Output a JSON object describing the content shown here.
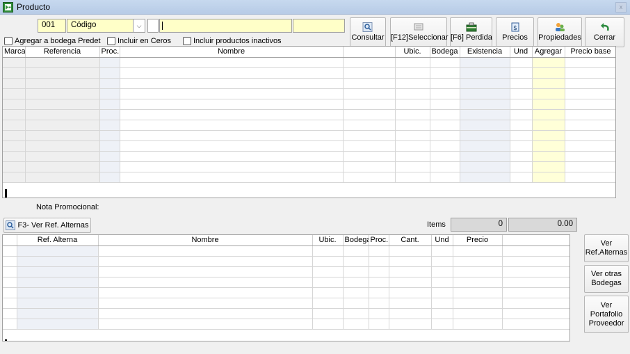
{
  "window": {
    "title": "Producto",
    "close_glyph": "x"
  },
  "search_bar": {
    "code_value": "001",
    "search_by_value": "Código",
    "search_value": "",
    "extra_value": ""
  },
  "options": {
    "add_default_warehouse": "Agregar a bodega Predet",
    "include_zeros": "Incluir en Ceros",
    "include_inactive": "Incluir productos inactivos"
  },
  "toolbar": {
    "consultar": "Consultar",
    "seleccionar": "[F12]Seleccionar",
    "perdida": "[F6] Perdida",
    "precios": "Precios",
    "propiedades": "Propiedades",
    "cerrar": "Cerrar"
  },
  "products_grid": {
    "columns": [
      "Marca",
      "Referencia",
      "Proc.",
      "Nombre",
      "",
      "Ubic.",
      "Bodega",
      "Existencia",
      "Und",
      "Agregar",
      "Precio base"
    ]
  },
  "promo": {
    "label": "Nota Promocional:"
  },
  "alt_button": {
    "label": "F3- Ver Ref. Alternas"
  },
  "items": {
    "label": "Items",
    "count": "0",
    "total": "0.00"
  },
  "alternates_grid": {
    "columns": [
      "",
      "Ref. Alterna",
      "Nombre",
      "Ubic.",
      "Bodega",
      "Proc.",
      "Cant.",
      "Und",
      "Precio",
      ""
    ]
  },
  "side_buttons": {
    "ver_alternas": "Ver Ref.Alternas",
    "ver_bodegas": "Ver otras Bodegas",
    "ver_portafolio": "Ver Portafolio Proveedor"
  },
  "colors": {
    "highlight_yellow": "#ffffc8",
    "titlebar": "#c7d9ef"
  }
}
